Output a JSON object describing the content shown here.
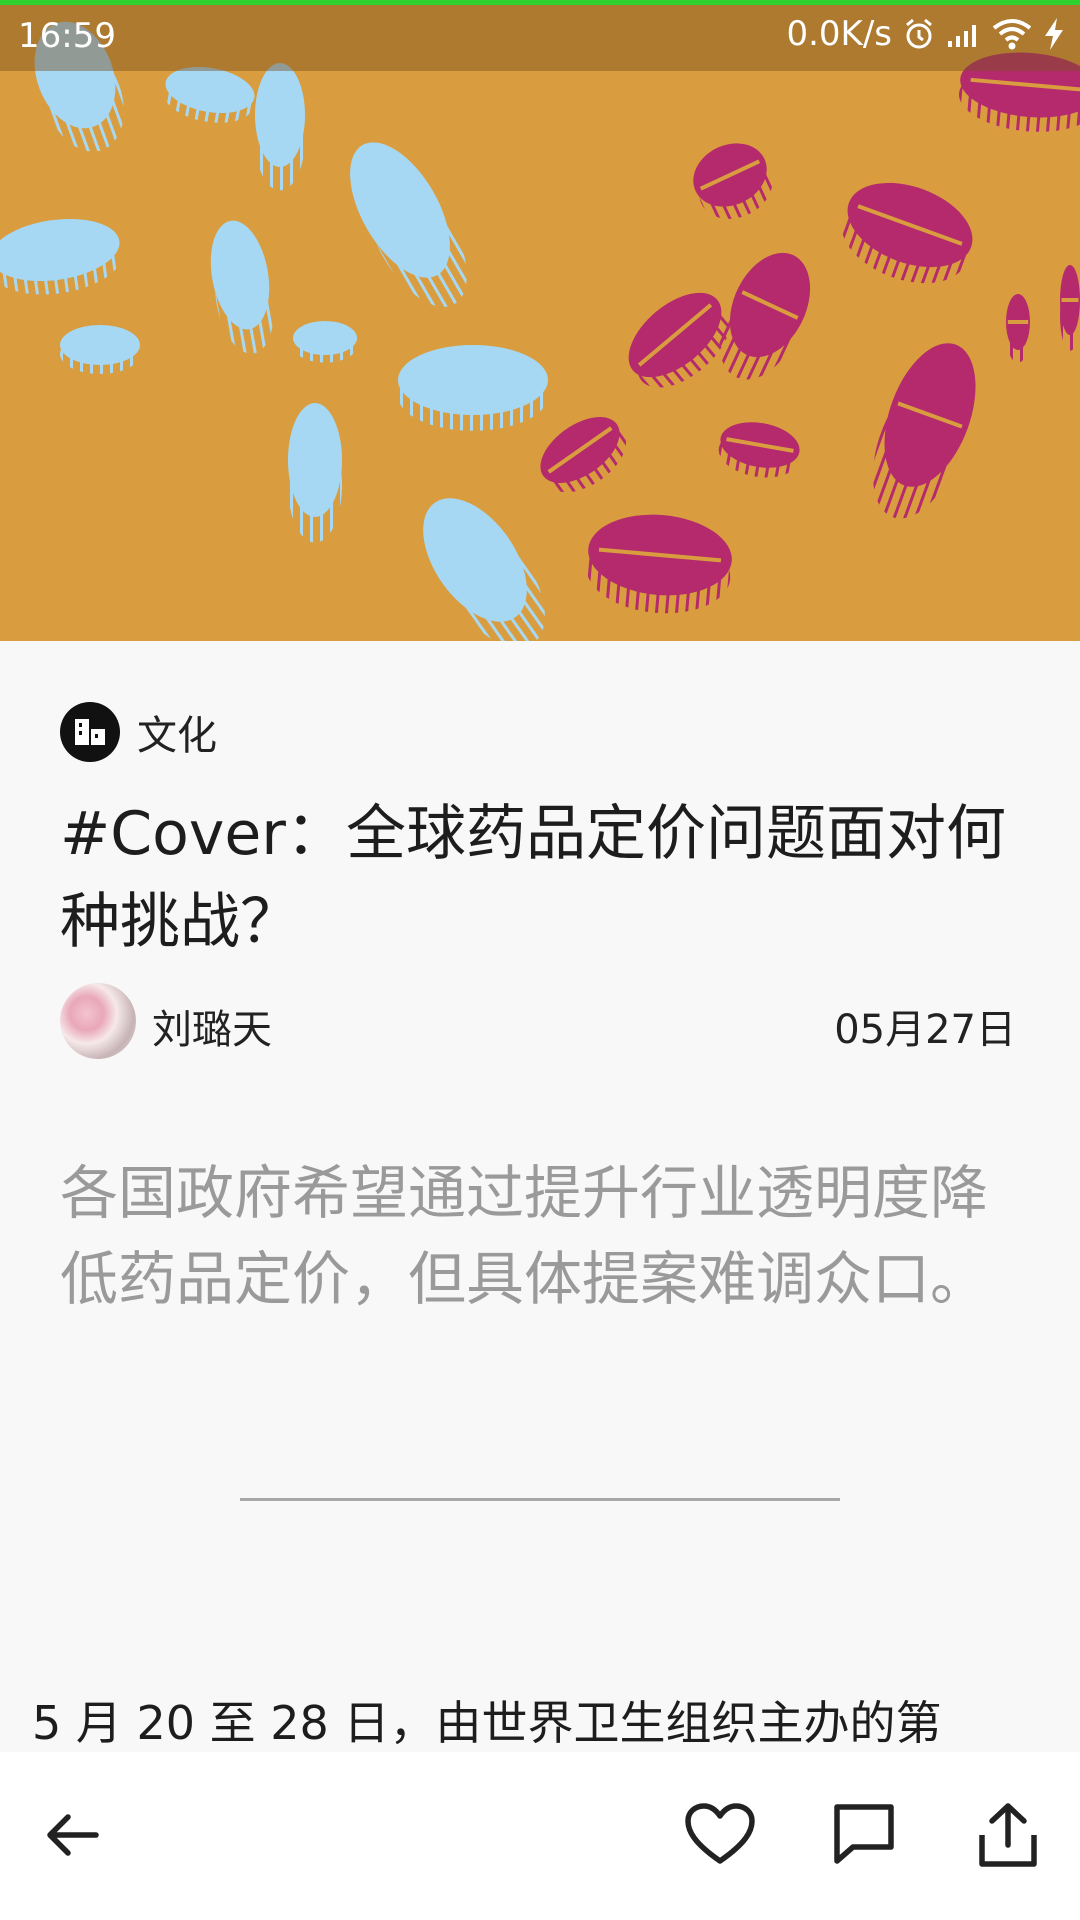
{
  "status_bar": {
    "time": "16:59",
    "net_speed": "0.0K/s",
    "icons": [
      "alarm-icon",
      "signal-icon",
      "wifi-icon",
      "charging-icon"
    ]
  },
  "hero": {
    "background": "#d99d3f",
    "coin_colors": [
      "#a6d8f4",
      "#b42a6c"
    ]
  },
  "article": {
    "category_icon": "building-icon",
    "category": "文化",
    "title": "#Cover：全球药品定价问题面对何种挑战？",
    "author": "刘璐天",
    "date": "05月27日",
    "summary": "各国政府希望通过提升行业透明度降低药品定价，但具体提案难调众口。",
    "body_first_line": "5 月 20 至 28 日，由世界卫生组织主办的第"
  },
  "toolbar": {
    "icons": [
      "back-arrow-icon",
      "heart-icon",
      "comment-icon",
      "share-icon"
    ]
  }
}
